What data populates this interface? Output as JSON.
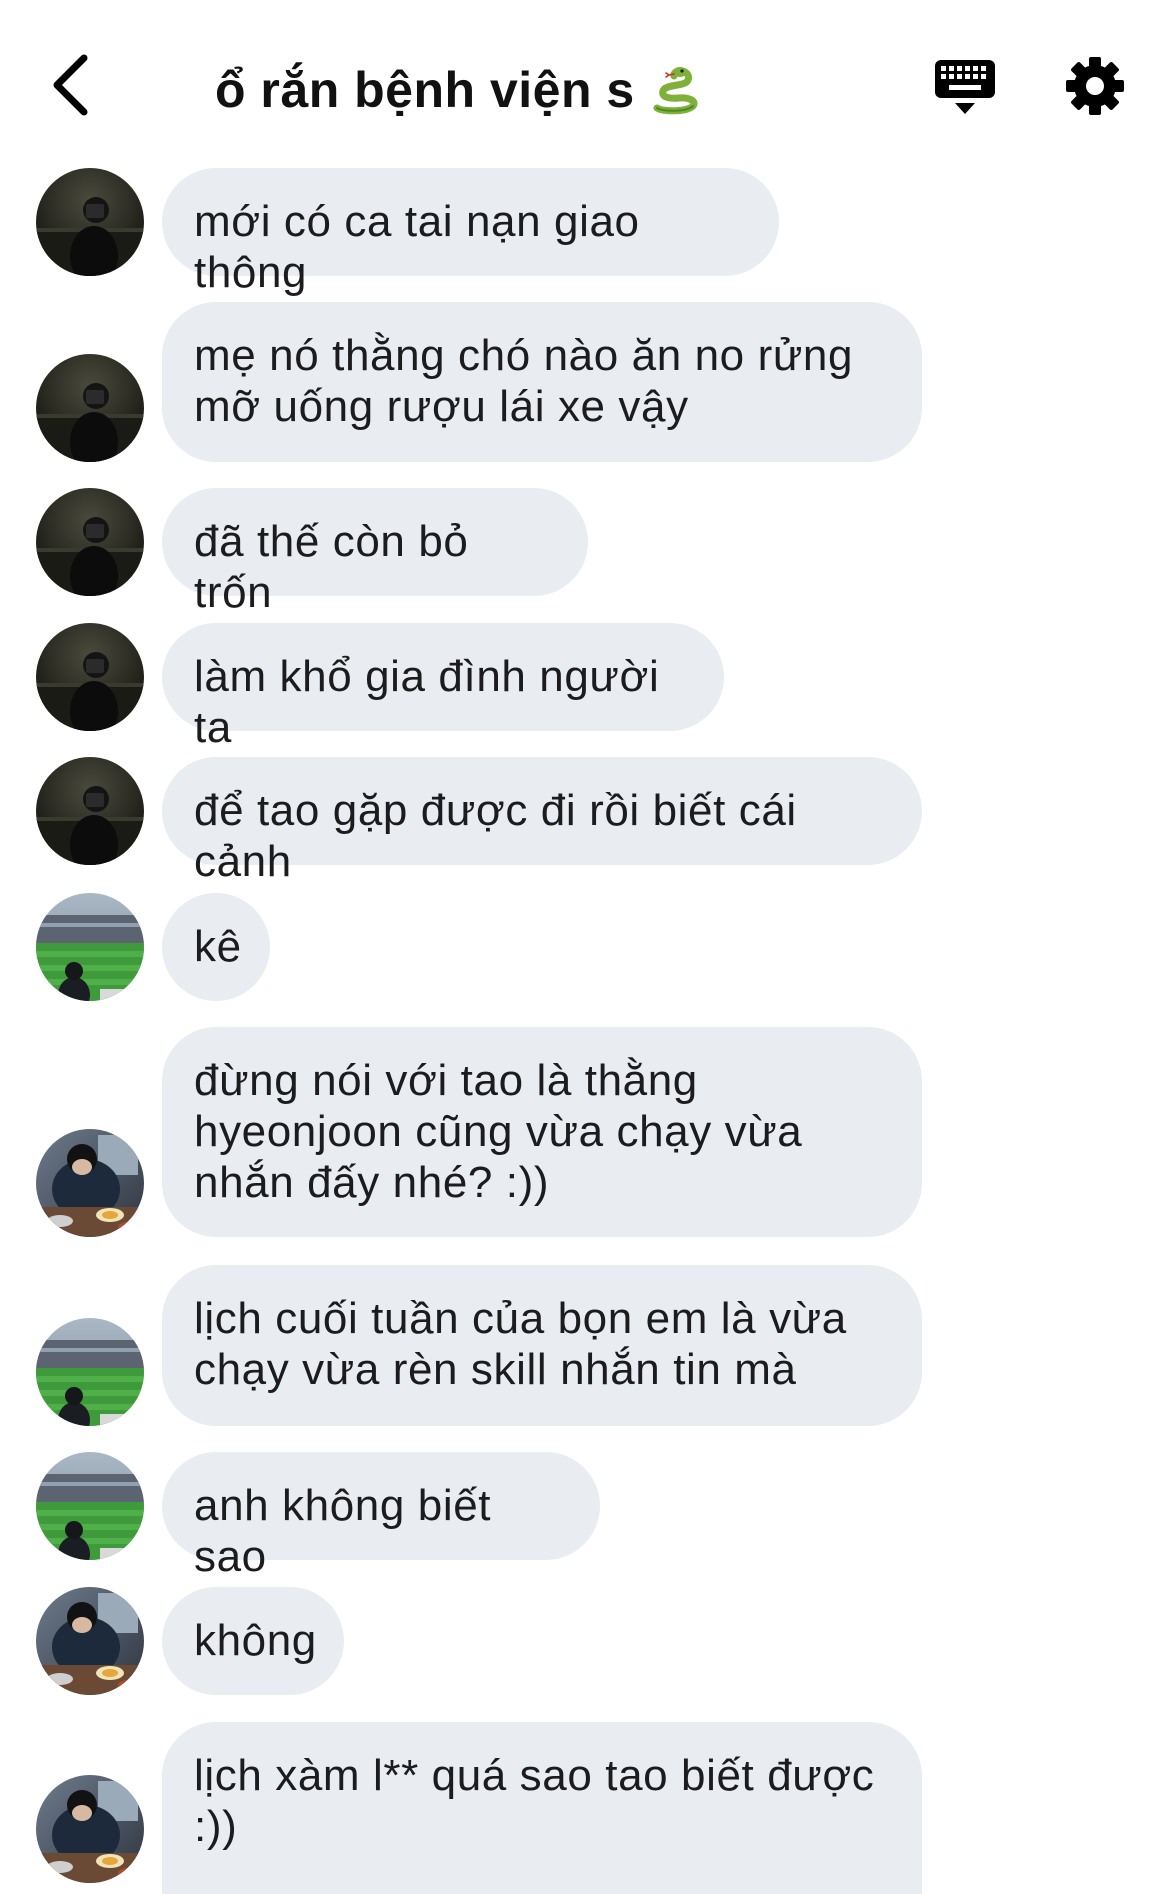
{
  "header": {
    "title": "ổ rắn bệnh viện s",
    "title_emoji": "snake-emoji",
    "back_icon": "chevron-left-icon",
    "keyboard_icon": "keyboard-icon",
    "settings_icon": "gear-icon"
  },
  "colors": {
    "bubble_bg": "#e9ecf0",
    "text": "#1c1c1e",
    "icon": "#000000"
  },
  "messages": [
    {
      "avatar": "night-selfie-avatar",
      "text": "mới có ca tai nạn giao thông"
    },
    {
      "avatar": "night-selfie-avatar",
      "text": "mẹ nó thằng chó nào ăn no rửng mỡ uống rượu lái xe vậy"
    },
    {
      "avatar": "night-selfie-avatar",
      "text": "đã thế còn bỏ trốn"
    },
    {
      "avatar": "night-selfie-avatar",
      "text": "làm khổ gia đình người ta"
    },
    {
      "avatar": "night-selfie-avatar",
      "text": "để tao gặp được đi rồi biết cái cảnh"
    },
    {
      "avatar": "stadium-avatar",
      "text": "kê"
    },
    {
      "avatar": "dining-avatar",
      "text": "đừng nói với tao là thằng hyeonjoon cũng vừa chạy vừa nhắn đấy nhé? :))"
    },
    {
      "avatar": "stadium-avatar",
      "text": "lịch cuối tuần của bọn em là vừa chạy vừa rèn skill nhắn tin mà"
    },
    {
      "avatar": "stadium-avatar",
      "text": "anh không biết sao"
    },
    {
      "avatar": "dining-avatar",
      "text": "không"
    },
    {
      "avatar": "dining-avatar",
      "text": "lịch xàm l** quá sao tao biết được :))"
    }
  ]
}
